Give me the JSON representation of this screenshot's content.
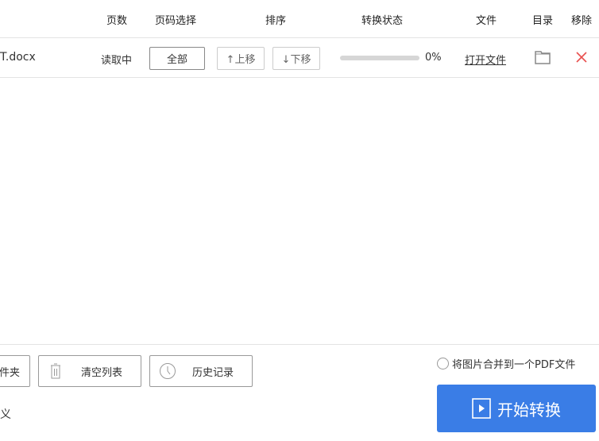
{
  "headers": {
    "pages": "页数",
    "page_select": "页码选择",
    "order": "排序",
    "status": "转换状态",
    "file": "文件",
    "folder": "目录",
    "remove": "移除"
  },
  "row": {
    "filename": "T.docx",
    "pages": "读取中",
    "page_select": "全部",
    "move_up": "↑上移",
    "move_down": "↓下移",
    "progress_percent": 0,
    "progress_text": "0%",
    "open_file": "打开文件"
  },
  "footer": {
    "folder_btn": "件夹",
    "clear_list": "清空列表",
    "history": "历史记录",
    "custom_label": "义",
    "merge_option": "将图片合并到一个PDF文件",
    "start": "开始转换"
  },
  "colors": {
    "accent": "#3a7de6",
    "remove": "#e8504f"
  }
}
